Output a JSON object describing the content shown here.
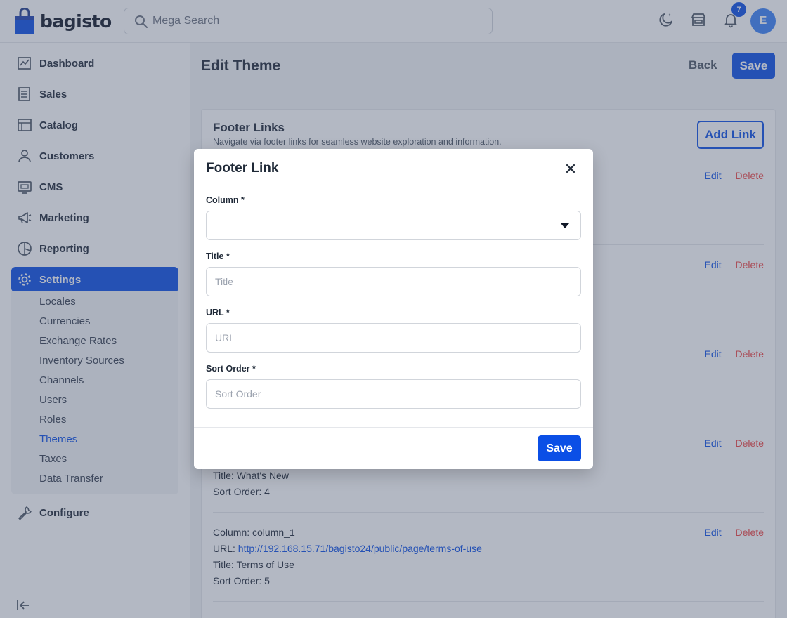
{
  "header": {
    "logo_text": "bagisto",
    "search_placeholder": "Mega Search",
    "notification_count": "7",
    "avatar_initial": "E"
  },
  "sidebar": {
    "items": [
      {
        "label": "Dashboard",
        "icon": "dashboard-icon"
      },
      {
        "label": "Sales",
        "icon": "sales-icon"
      },
      {
        "label": "Catalog",
        "icon": "catalog-icon"
      },
      {
        "label": "Customers",
        "icon": "customers-icon"
      },
      {
        "label": "CMS",
        "icon": "cms-icon"
      },
      {
        "label": "Marketing",
        "icon": "marketing-icon"
      },
      {
        "label": "Reporting",
        "icon": "reporting-icon"
      },
      {
        "label": "Settings",
        "icon": "settings-icon",
        "active": true
      },
      {
        "label": "Configure",
        "icon": "configure-icon"
      }
    ],
    "settings_sub": [
      "Locales",
      "Currencies",
      "Exchange Rates",
      "Inventory Sources",
      "Channels",
      "Users",
      "Roles",
      "Themes",
      "Taxes",
      "Data Transfer"
    ],
    "active_sub": "Themes"
  },
  "main": {
    "page_title": "Edit Theme",
    "back_label": "Back",
    "save_label": "Save",
    "card": {
      "title": "Footer Links",
      "subtitle": "Navigate via footer links for seamless website exploration and information.",
      "add_link_label": "Add Link",
      "edit_label": "Edit",
      "delete_label": "Delete",
      "entries": [
        {
          "lines": [
            "Title: What's New",
            "Sort Order: 4"
          ]
        },
        {
          "column": "Column: column_1",
          "url_label": "URL: ",
          "url": "http://192.168.15.71/bagisto24/public/page/terms-of-use",
          "title": "Title: Terms of Use",
          "sort": "Sort Order: 5"
        }
      ]
    }
  },
  "modal": {
    "title": "Footer Link",
    "column_label": "Column *",
    "column_value": "",
    "title_label": "Title *",
    "title_placeholder": "Title",
    "url_label": "URL *",
    "url_placeholder": "URL",
    "sort_label": "Sort Order *",
    "sort_placeholder": "Sort Order",
    "save_label": "Save"
  },
  "colors": {
    "accent": "#0b4fe6",
    "delete": "#ef4444",
    "overlay": "#4b5571"
  }
}
